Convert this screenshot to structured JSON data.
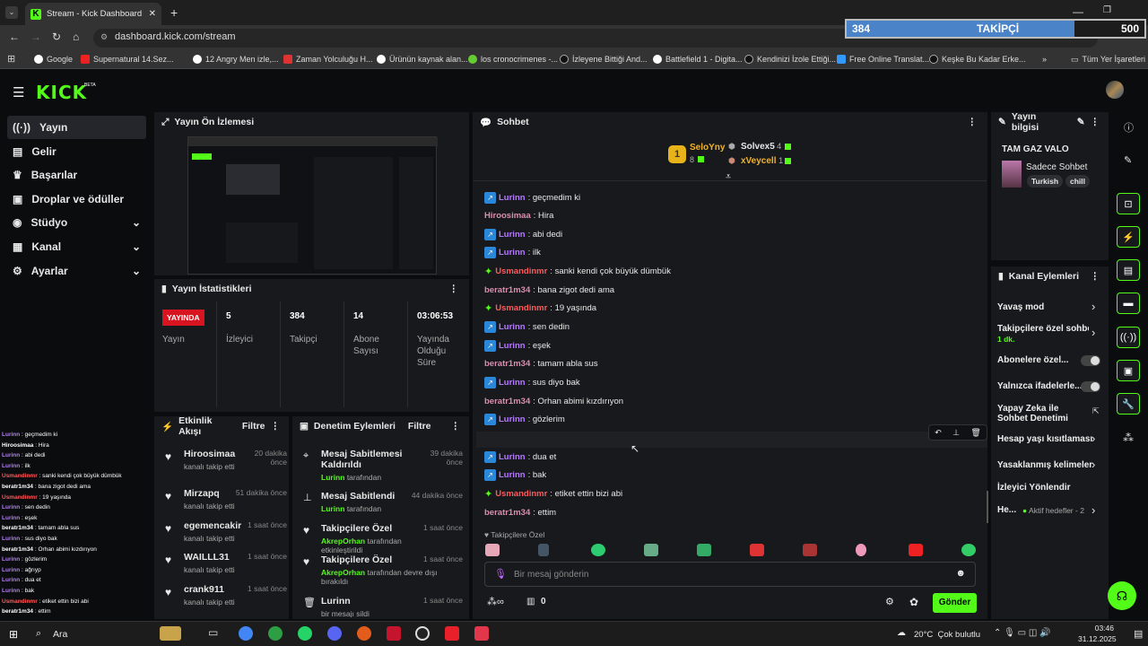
{
  "browser": {
    "tab_title": "Stream - Kick Dashboard",
    "url": "dashboard.kick.com/stream",
    "bookmarks": [
      "Google",
      "Supernatural 14.Sez...",
      "12 Angry Men izle,...",
      "Zaman Yolculuğu H...",
      "Ürünün kaynak alan...",
      "los cronocrimenes -...",
      "İzleyene Bittiği And...",
      "Battlefield 1 - Digita...",
      "Kendinizi İzole Ettiği...",
      "Free Online Translat...",
      "Keşke Bu Kadar Erke..."
    ],
    "all_bookmarks": "Tüm Yer İşaretleri"
  },
  "follower_widget": {
    "count": "384",
    "label": "TAKİPÇİ",
    "goal": "500"
  },
  "brand": {
    "logo": "KICK",
    "beta": "BETA",
    "accent": "#53fc18"
  },
  "sidebar": {
    "items": [
      {
        "label": "Yayın",
        "icon": "broadcast-icon"
      },
      {
        "label": "Gelir",
        "icon": "revenue-icon"
      },
      {
        "label": "Başarılar",
        "icon": "trophy-icon"
      },
      {
        "label": "Droplar ve ödüller",
        "icon": "gift-icon"
      },
      {
        "label": "Stüdyo",
        "icon": "studio-icon"
      },
      {
        "label": "Kanal",
        "icon": "channel-icon"
      },
      {
        "label": "Ayarlar",
        "icon": "gear-icon"
      }
    ]
  },
  "preview": {
    "title": "Yayın Ön İzlemesi"
  },
  "stats": {
    "title": "Yayın İstatistikleri",
    "live": "YAYINDA",
    "live_label": "Yayın",
    "items": [
      {
        "value": "5",
        "label": "İzleyici"
      },
      {
        "value": "384",
        "label": "Takipçi"
      },
      {
        "value": "14",
        "label": "Abone Sayısı"
      },
      {
        "value": "03:06:53",
        "label": "Yayında Olduğu Süre"
      }
    ]
  },
  "activity": {
    "title": "Etkinlik Akışı",
    "filter": "Filtre",
    "items": [
      {
        "name": "Hiroosimaa",
        "sub": "kanalı takip etti",
        "time": "20 dakika önce"
      },
      {
        "name": "Mirzapq",
        "sub": "kanalı takip etti",
        "time": "51 dakika önce"
      },
      {
        "name": "egemencakir",
        "sub": "kanalı takip etti",
        "time": "1 saat önce"
      },
      {
        "name": "WAILLL31",
        "sub": "kanalı takip etti",
        "time": "1 saat önce"
      },
      {
        "name": "crank911",
        "sub": "kanalı takip etti",
        "time": "1 saat önce"
      }
    ]
  },
  "moderation": {
    "title": "Denetim Eylemleri",
    "filter": "Filtre",
    "items": [
      {
        "title": "Mesaj Sabitlemesi Kaldırıldı",
        "user": "Lurinn",
        "sub": " tarafından",
        "time": "39 dakika önce"
      },
      {
        "title": "Mesaj Sabitlendi",
        "user": "Lurinn",
        "sub": " tarafından",
        "time": "44 dakika önce"
      },
      {
        "title": "Takipçilere Özel",
        "user": "AkrepOrhan",
        "sub": " tarafından etkinleştirildi",
        "time": "1 saat önce"
      },
      {
        "title": "Takipçilere Özel",
        "user": "AkrepOrhan",
        "sub": " tarafından devre dışı bırakıldı",
        "time": "1 saat önce"
      },
      {
        "title": "Lurinn",
        "user": "",
        "sub": "bir mesajı sildi",
        "time": "1 saat önce"
      }
    ]
  },
  "chat": {
    "title": "Sohbet",
    "top": [
      {
        "name": "SeloYny",
        "count": "8"
      },
      {
        "name": "Solvex5",
        "count": "4"
      },
      {
        "name": "xVeycell",
        "count": "1"
      }
    ],
    "messages": [
      {
        "user": "Lurinn",
        "text": ": geçmedim ki",
        "color": "#b57bff",
        "badge": "sub"
      },
      {
        "user": "Hiroosimaa",
        "text": ": Hira",
        "color": "#d88fb0",
        "badge": ""
      },
      {
        "user": "Lurinn",
        "text": ": abi dedi",
        "color": "#b57bff",
        "badge": "sub"
      },
      {
        "user": "Lurinn",
        "text": ": ilk",
        "color": "#b57bff",
        "badge": "sub"
      },
      {
        "user": "Usmandinmr",
        "text": ": sanki kendi çok büyük dümbük",
        "color": "#ff5a5a",
        "badge": "gift"
      },
      {
        "user": "beratr1m34",
        "text": ": bana zigot dedi ama",
        "color": "#d88fb0",
        "badge": ""
      },
      {
        "user": "Usmandinmr",
        "text": ": 19 yaşında",
        "color": "#ff5a5a",
        "badge": "gift"
      },
      {
        "user": "Lurinn",
        "text": ": sen dedin",
        "color": "#b57bff",
        "badge": "sub"
      },
      {
        "user": "Lurinn",
        "text": ": eşek",
        "color": "#b57bff",
        "badge": "sub"
      },
      {
        "user": "beratr1m34",
        "text": ": tamam abla sus",
        "color": "#d88fb0",
        "badge": ""
      },
      {
        "user": "Lurinn",
        "text": ": sus diyo bak",
        "color": "#b57bff",
        "badge": "sub"
      },
      {
        "user": "beratr1m34",
        "text": ": Orhan abimi kızdırıyon",
        "color": "#d88fb0",
        "badge": ""
      },
      {
        "user": "Lurinn",
        "text": ": gözlerim",
        "color": "#b57bff",
        "badge": "sub"
      },
      {
        "user": "Lurinn",
        "text": ": ağrıyp",
        "color": "#b57bff",
        "badge": "sub"
      },
      {
        "user": "Lurinn",
        "text": ": dua et",
        "color": "#b57bff",
        "badge": "sub"
      },
      {
        "user": "Lurinn",
        "text": ": bak",
        "color": "#b57bff",
        "badge": "sub"
      },
      {
        "user": "Usmandinmr",
        "text": ": etiket ettin bizi abi",
        "color": "#ff5a5a",
        "badge": "gift"
      },
      {
        "user": "beratr1m34",
        "text": ": ettim",
        "color": "#d88fb0",
        "badge": ""
      }
    ],
    "followers_only": "Takipçilere Özel",
    "placeholder": "Bir mesaj gönderin",
    "points": "0",
    "send": "Gönder"
  },
  "stream_info": {
    "title": "Yayın bilgisi",
    "stream_title": "TAM GAZ VALO",
    "category": "Sadece Sohbet",
    "tags": [
      "Turkish",
      "chill"
    ]
  },
  "channel_actions": {
    "title": "Kanal Eylemleri",
    "items": [
      {
        "label": "Yavaş mod",
        "kind": "arrow"
      },
      {
        "label": "Takipçilere özel sohbe",
        "sub": "1 dk.",
        "kind": "arrow"
      },
      {
        "label": "Abonelere özel...",
        "kind": "toggle"
      },
      {
        "label": "Yalnızca ifadelerle...",
        "kind": "toggle"
      },
      {
        "label": "Yapay Zeka ile Sohbet Denetimi",
        "kind": "ext"
      },
      {
        "label": "Hesap yaşı kısıtlaması",
        "kind": "arrow"
      },
      {
        "label": "Yasaklanmış kelimeler",
        "kind": "arrow"
      },
      {
        "label": "İzleyici Yönlendir",
        "kind": "none"
      },
      {
        "label": "He...",
        "sub": "Aktif hedefler - 2",
        "kind": "arrow"
      }
    ]
  },
  "overlay_chat": [
    {
      "u": "Lurinn",
      "t": " : geçmedim ki",
      "c": "#b57bff"
    },
    {
      "u": "Hiroosimaa",
      "t": " : Hira",
      "c": "#fff"
    },
    {
      "u": "Lurinn",
      "t": " : abi dedi",
      "c": "#b57bff"
    },
    {
      "u": "Lurinn",
      "t": " : ilk",
      "c": "#b57bff"
    },
    {
      "u": "Usmandinmr",
      "t": " : sanki kendi çok büyük dümbük",
      "c": "#ff5a5a"
    },
    {
      "u": "beratr1m34",
      "t": " : bana zigot dedi ama",
      "c": "#fff"
    },
    {
      "u": "Usmandinmr",
      "t": " : 19 yaşında",
      "c": "#ff5a5a"
    },
    {
      "u": "Lurinn",
      "t": " : sen dedin",
      "c": "#b57bff"
    },
    {
      "u": "Lurinn",
      "t": " : eşek",
      "c": "#b57bff"
    },
    {
      "u": "beratr1m34",
      "t": " : tamam abla sus",
      "c": "#fff"
    },
    {
      "u": "Lurinn",
      "t": " : sus diyo bak",
      "c": "#b57bff"
    },
    {
      "u": "beratr1m34",
      "t": " : Orhan abimi kızdırıyon",
      "c": "#fff"
    },
    {
      "u": "Lurinn",
      "t": " : gözlerim",
      "c": "#b57bff"
    },
    {
      "u": "Lurinn",
      "t": " : ağrıyp",
      "c": "#b57bff"
    },
    {
      "u": "Lurinn",
      "t": " : dua et",
      "c": "#b57bff"
    },
    {
      "u": "Lurinn",
      "t": " : bak",
      "c": "#b57bff"
    },
    {
      "u": "Usmandinmr",
      "t": " : etiket ettin bizi abi",
      "c": "#ff5a5a"
    },
    {
      "u": "beratr1m34",
      "t": " : ettim",
      "c": "#fff"
    }
  ],
  "taskbar": {
    "search": "Ara",
    "weather": "20°C  Çok bulutlu",
    "time": "03:46",
    "date": "31.12.2025"
  }
}
